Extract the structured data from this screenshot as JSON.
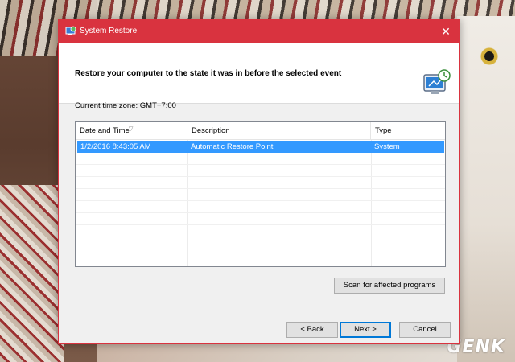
{
  "window": {
    "title": "System Restore",
    "close_glyph": "✕"
  },
  "header": {
    "title": "Restore your computer to the state it was in before the selected event",
    "icon": "system-restore-monitor-icon"
  },
  "timezone_label": "Current time zone: GMT+7:00",
  "table": {
    "columns": [
      "Date and Time",
      "Description",
      "Type"
    ],
    "sorted_column": "Date and Time",
    "sort_glyph": "▽",
    "rows": [
      {
        "date": "1/2/2016 8:43:05 AM",
        "description": "Automatic Restore Point",
        "type": "System",
        "selected": true
      }
    ]
  },
  "buttons": {
    "scan": "Scan for affected programs",
    "back": "< Back",
    "next": "Next >",
    "cancel": "Cancel"
  },
  "watermark": "GENK",
  "colors": {
    "titlebar": "#d9333f",
    "selection": "#3399ff",
    "default_button_border": "#0078d7"
  }
}
